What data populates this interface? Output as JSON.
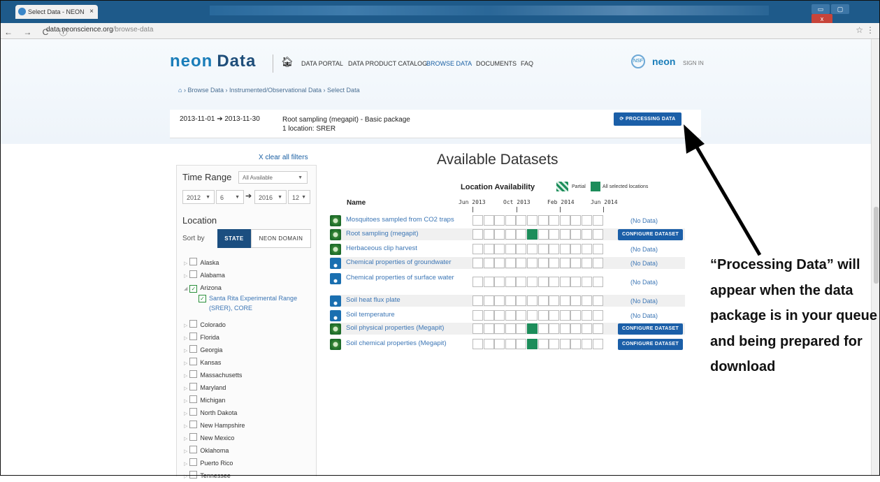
{
  "browser": {
    "tab_title": "Select Data - NEON Data",
    "tab_close": "×",
    "url_host": "data.neonscience.org",
    "url_path": "/browse-data",
    "nav_controls": "← → C ⓘ",
    "window_buttons": [
      "▭",
      "▢",
      "x"
    ]
  },
  "header": {
    "logo": "neon",
    "logo_suffix": "Data",
    "nav": [
      "DATA PORTAL",
      "DATA PRODUCT CATALOG",
      "BROWSE DATA",
      "DOCUMENTS",
      "FAQ"
    ],
    "active_nav": "BROWSE DATA",
    "nsf": "NSF",
    "neon_small": "neon",
    "sign_in": "SIGN IN"
  },
  "breadcrumb": [
    "Browse Data",
    "Instrumented/Observational Data",
    "Select Data"
  ],
  "summary": {
    "dates": "2013-11-01 ➔ 2013-11-30",
    "product": "Root sampling (megapit) - Basic package",
    "locations": "1 location: SRER",
    "processing_button": "PROCESSING DATA"
  },
  "sidebar": {
    "clear_filters": "X clear all filters",
    "time_range_label": "Time Range",
    "time_range_value": "All Available",
    "start_year": "2012",
    "start_month": "6",
    "end_year": "2016",
    "end_month": "12",
    "location_label": "Location",
    "sort_by": "Sort by",
    "sort_state": "STATE",
    "sort_domain": "NEON DOMAIN",
    "states": [
      {
        "name": "Alaska",
        "checked": false,
        "expanded": false
      },
      {
        "name": "Alabama",
        "checked": false,
        "expanded": false
      },
      {
        "name": "Arizona",
        "checked": true,
        "expanded": true
      },
      {
        "name": "Colorado",
        "checked": false,
        "expanded": false
      },
      {
        "name": "Florida",
        "checked": false,
        "expanded": false
      },
      {
        "name": "Georgia",
        "checked": false,
        "expanded": false
      },
      {
        "name": "Kansas",
        "checked": false,
        "expanded": false
      },
      {
        "name": "Massachusetts",
        "checked": false,
        "expanded": false
      },
      {
        "name": "Maryland",
        "checked": false,
        "expanded": false
      },
      {
        "name": "Michigan",
        "checked": false,
        "expanded": false
      },
      {
        "name": "North Dakota",
        "checked": false,
        "expanded": false
      },
      {
        "name": "New Hampshire",
        "checked": false,
        "expanded": false
      },
      {
        "name": "New Mexico",
        "checked": false,
        "expanded": false
      },
      {
        "name": "Oklahoma",
        "checked": false,
        "expanded": false
      },
      {
        "name": "Puerto Rico",
        "checked": false,
        "expanded": false
      },
      {
        "name": "Tennessee",
        "checked": false,
        "expanded": false
      }
    ],
    "site": "Santa Rita Experimental Range (SRER), CORE"
  },
  "main": {
    "title": "Available Datasets",
    "location_availability": "Location Availability",
    "legend_partial": "Partial",
    "legend_all": "All selected locations",
    "name_header": "Name",
    "timeline_labels": [
      "Jun 2013",
      "Oct 2013",
      "Feb 2014",
      "Jun 2014"
    ],
    "no_data": "(No Data)",
    "configure": "CONFIGURE DATASET",
    "datasets": [
      {
        "name": "Mosquitoes sampled from CO2 traps",
        "icon": "green",
        "filled": [],
        "action": "nodata"
      },
      {
        "name": "Root sampling (megapit)",
        "icon": "green",
        "filled": [
          5
        ],
        "action": "configure"
      },
      {
        "name": "Herbaceous clip harvest",
        "icon": "green",
        "filled": [],
        "action": "nodata"
      },
      {
        "name": "Chemical properties of groundwater",
        "icon": "blue",
        "filled": [],
        "action": "nodata"
      },
      {
        "name": "Chemical properties of surface water",
        "icon": "blue",
        "filled": [],
        "action": "nodata"
      },
      {
        "name": "Soil heat flux plate",
        "icon": "blue",
        "filled": [],
        "action": "nodata"
      },
      {
        "name": "Soil temperature",
        "icon": "blue",
        "filled": [],
        "action": "nodata"
      },
      {
        "name": "Soil physical properties (Megapit)",
        "icon": "green",
        "filled": [
          5
        ],
        "action": "configure"
      },
      {
        "name": "Soil chemical properties (Megapit)",
        "icon": "green",
        "filled": [
          5
        ],
        "action": "configure"
      }
    ]
  },
  "annotation": "“Processing Data” will appear when the data package is in your queue and being prepared for download",
  "colors": {
    "accent": "#1b5fa8",
    "available": "#1c8d5a",
    "link": "#3c76b5"
  }
}
